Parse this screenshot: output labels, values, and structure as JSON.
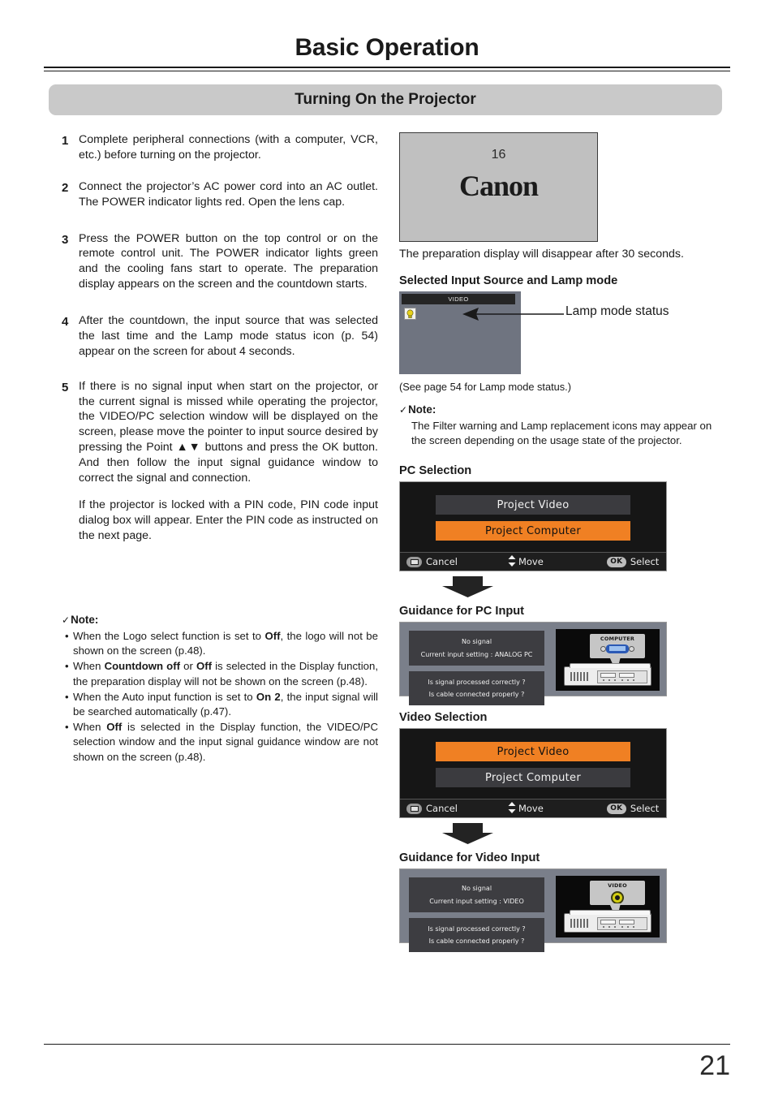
{
  "header": {
    "title": "Basic Operation",
    "section_title": "Turning On the Projector"
  },
  "steps": [
    {
      "number": "1",
      "text": "Complete peripheral connections (with a computer, VCR, etc.) before turning on the projector."
    },
    {
      "number": "2",
      "text": "Connect the projector’s AC power cord into an AC outlet. The POWER indicator lights red. Open the lens cap."
    },
    {
      "number": "3",
      "text": "Press the POWER button on the top control or on the remote control unit. The POWER indicator lights green and the cooling fans start to operate. The preparation display appears on the screen and the countdown starts."
    },
    {
      "number": "4",
      "text": "After the countdown, the input source that was selected the last time and the Lamp mode status icon (p. 54) appear on the screen for about 4 seconds."
    },
    {
      "number": "5",
      "text": "If there is no signal input when start on the projector, or the current signal is missed while operating the projector, the VIDEO/PC selection window will be displayed on the screen, please move the pointer to input source desired by pressing the Point ▲▼ buttons and press the OK button. And then follow the input signal guidance window to correct the signal and connection.",
      "text2": "If the projector is locked with a PIN code, PIN code input dialog box will appear. Enter the PIN code as instructed on the next page."
    }
  ],
  "left_note": {
    "check_mark": "✓",
    "heading": "Note:",
    "bullet": "•",
    "items": [
      {
        "a": "When the Logo select function is set to ",
        "b": "Off",
        "c": ", the logo will not be shown on the screen (p.48)."
      },
      {
        "a": "When ",
        "b": "Countdown off",
        "c": " or ",
        "d": "Off",
        "e": " is selected in the Display function, the preparation display will not be shown on the screen (p.48)."
      },
      {
        "a": "When the Auto input function is set to ",
        "b": "On 2",
        "c": ", the input signal will be searched automatically (p.47)."
      },
      {
        "a": "When ",
        "b": "Off",
        "c": " is selected in the Display function, the VIDEO/PC selection window and the input signal guidance window are not shown on the screen (p.48)."
      }
    ]
  },
  "right": {
    "prep_screen": {
      "countdown": "16",
      "logo_text": "Canon"
    },
    "prep_caption": "The preparation display will disappear after 30 seconds.",
    "lamp_section": {
      "heading": "Selected Input Source and Lamp mode",
      "osd_source_label": "VIDEO",
      "callout_label": "Lamp mode status",
      "see_page": "(See page 54 for Lamp mode status.)"
    },
    "note": {
      "check_mark": "✓",
      "heading": "Note:",
      "text": "The Filter warning and Lamp replacement icons may appear on the screen depending on the usage state of the projector."
    },
    "pc_selection": {
      "heading": "PC Selection",
      "items": [
        {
          "label": "Project Video",
          "selected": false
        },
        {
          "label": "Project Computer",
          "selected": true
        }
      ],
      "footer": {
        "cancel": "Cancel",
        "move": "Move",
        "ok_key": "OK",
        "select": "Select"
      }
    },
    "pc_guidance": {
      "heading": "Guidance for PC Input",
      "line1": "No signal",
      "line2": "Current input setting : ANALOG PC",
      "line3": "Is signal processed correctly ?",
      "line4": "Is cable connected properly ?",
      "connector_label": "COMPUTER"
    },
    "video_selection": {
      "heading": "Video Selection",
      "items": [
        {
          "label": "Project Video",
          "selected": true
        },
        {
          "label": "Project Computer",
          "selected": false
        }
      ],
      "footer": {
        "cancel": "Cancel",
        "move": "Move",
        "ok_key": "OK",
        "select": "Select"
      }
    },
    "video_guidance": {
      "heading": "Guidance for Video Input",
      "line1": "No signal",
      "line2": "Current input setting : VIDEO",
      "line3": "Is signal processed correctly ?",
      "line4": "Is cable connected properly ?",
      "connector_label": "VIDEO"
    }
  },
  "footer": {
    "page_number": "21"
  },
  "colors": {
    "section_bar": "#c9c9c9",
    "osd_selected": "#f08023",
    "osd_item": "#3b3b3f",
    "osd_background": "#161616",
    "guidance_background": "#7a7f8a",
    "lamp_icon": "#e8d21a"
  }
}
